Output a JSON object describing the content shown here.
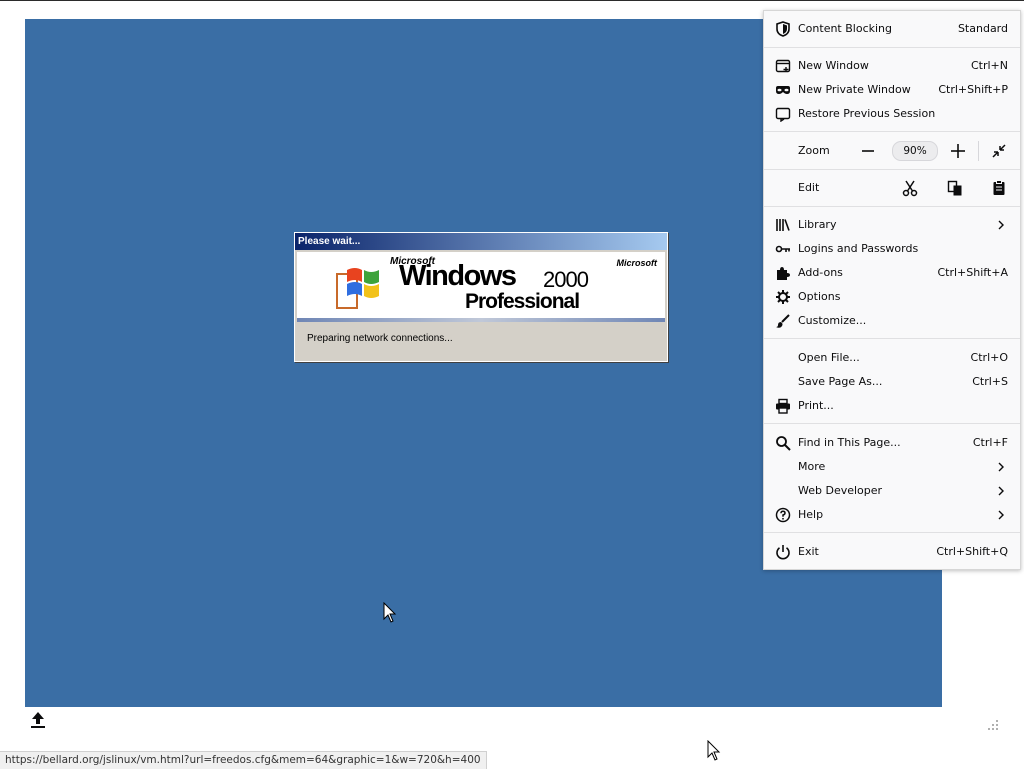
{
  "vm": {
    "dialog_title": "Please wait...",
    "brand_small": "Microsoft",
    "brand_right": "Microsoft",
    "product_word": "Windows",
    "product_year": "2000",
    "product_edition": "Professional",
    "status_text": "Preparing network connections...",
    "screen_color": "#3a6ea5"
  },
  "menu": {
    "content_blocking": {
      "label": "Content Blocking",
      "value": "Standard",
      "icon": "shield-icon"
    },
    "new_window": {
      "label": "New Window",
      "shortcut": "Ctrl+N",
      "icon": "new-window-icon"
    },
    "new_private_window": {
      "label": "New Private Window",
      "shortcut": "Ctrl+Shift+P",
      "icon": "mask-icon"
    },
    "restore_session": {
      "label": "Restore Previous Session",
      "icon": "restore-icon"
    },
    "zoom": {
      "label": "Zoom",
      "value": "90%"
    },
    "edit": {
      "label": "Edit"
    },
    "library": {
      "label": "Library",
      "icon": "library-icon"
    },
    "logins": {
      "label": "Logins and Passwords",
      "icon": "key-icon"
    },
    "addons": {
      "label": "Add-ons",
      "shortcut": "Ctrl+Shift+A",
      "icon": "puzzle-icon"
    },
    "options": {
      "label": "Options",
      "icon": "gear-icon"
    },
    "customize": {
      "label": "Customize...",
      "icon": "brush-icon"
    },
    "open_file": {
      "label": "Open File...",
      "shortcut": "Ctrl+O"
    },
    "save_page": {
      "label": "Save Page As...",
      "shortcut": "Ctrl+S"
    },
    "print": {
      "label": "Print...",
      "icon": "printer-icon"
    },
    "find": {
      "label": "Find in This Page...",
      "shortcut": "Ctrl+F",
      "icon": "search-icon"
    },
    "more": {
      "label": "More"
    },
    "web_developer": {
      "label": "Web Developer"
    },
    "help": {
      "label": "Help",
      "icon": "help-icon"
    },
    "exit": {
      "label": "Exit",
      "shortcut": "Ctrl+Shift+Q",
      "icon": "power-icon"
    }
  },
  "status_bar": {
    "url": "https://bellard.org/jslinux/vm.html?url=freedos.cfg&mem=64&graphic=1&w=720&h=400"
  }
}
